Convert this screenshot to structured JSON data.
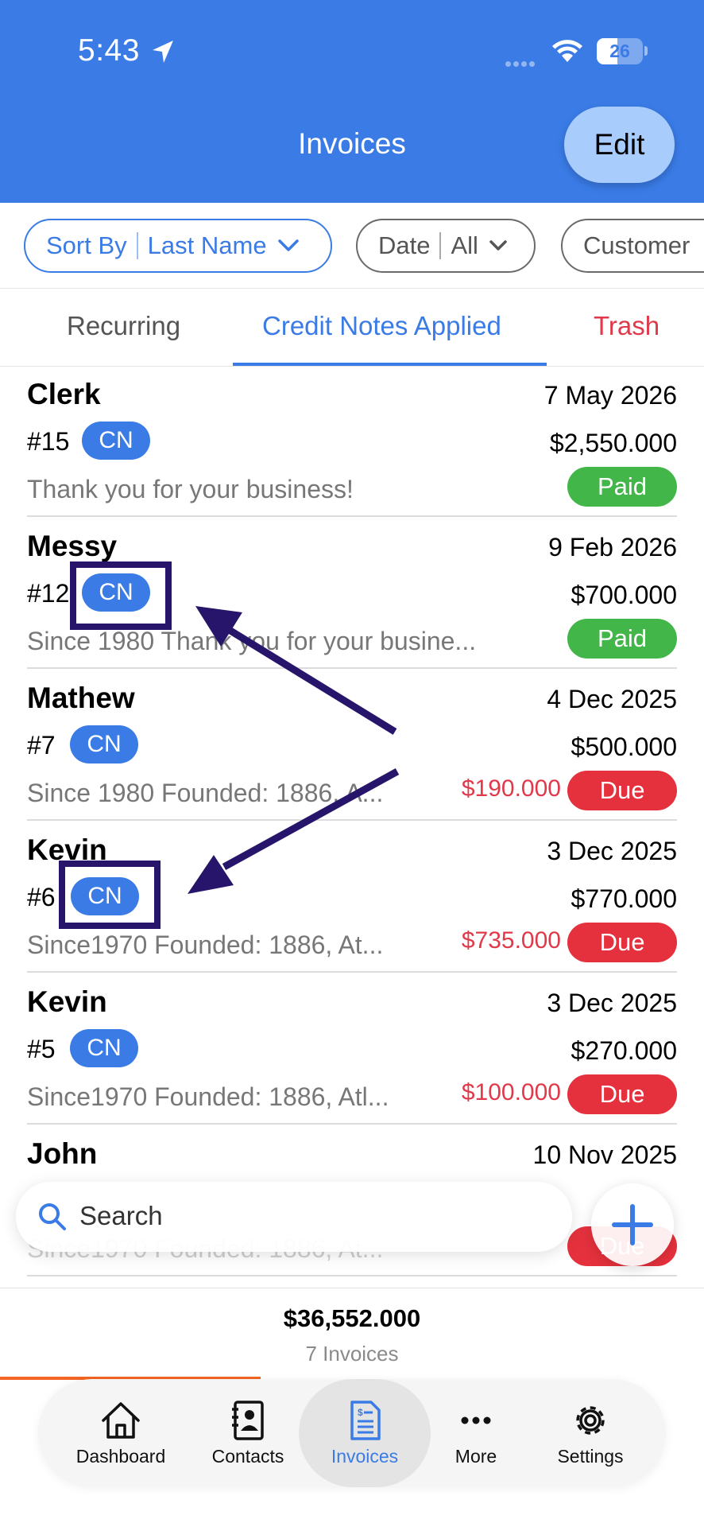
{
  "status_bar": {
    "time": "5:43",
    "battery": "26"
  },
  "header": {
    "title": "Invoices",
    "edit_label": "Edit"
  },
  "filters": [
    {
      "label": "Sort By",
      "value": "Last Name"
    },
    {
      "label": "Date",
      "value": "All"
    },
    {
      "label": "Customer",
      "value": ""
    }
  ],
  "tabs": [
    {
      "label": "Recurring"
    },
    {
      "label": "Credit Notes Applied",
      "active": true
    },
    {
      "label": "Trash"
    }
  ],
  "invoices": [
    {
      "customer": "Clerk",
      "date": "7 May 2026",
      "number": "#15",
      "badge": "CN",
      "amount": "$2,550.000",
      "note": "Thank you for your business!",
      "balance": "",
      "status": "Paid"
    },
    {
      "customer": "Messy",
      "date": "9 Feb 2026",
      "number": "#12",
      "badge": "CN",
      "amount": "$700.000",
      "note": "Since 1980 Thank you for your busine...",
      "balance": "",
      "status": "Paid"
    },
    {
      "customer": "Mathew",
      "date": "4 Dec 2025",
      "number": "#7",
      "badge": "CN",
      "amount": "$500.000",
      "note": "Since 1980 Founded: 1886, A...",
      "balance": "$190.000",
      "status": "Due"
    },
    {
      "customer": "Kevin",
      "date": "3 Dec 2025",
      "number": "#6",
      "badge": "CN",
      "amount": "$770.000",
      "note": "Since1970 Founded: 1886, At...",
      "balance": "$735.000",
      "status": "Due"
    },
    {
      "customer": "Kevin",
      "date": "3 Dec 2025",
      "number": "#5",
      "badge": "CN",
      "amount": "$270.000",
      "note": "Since1970 Founded: 1886, Atl...",
      "balance": "$100.000",
      "status": "Due"
    },
    {
      "customer": "John",
      "date": "10 Nov 2025",
      "number": "",
      "badge": "",
      "amount": "",
      "note": "Since1970 Founded: 1886, At...",
      "balance": "",
      "status": "Due"
    }
  ],
  "search": {
    "placeholder": "Search"
  },
  "totals": {
    "amount": "$36,552.000",
    "count": "7 Invoices"
  },
  "nav": [
    {
      "label": "Dashboard",
      "icon": "house-icon"
    },
    {
      "label": "Contacts",
      "icon": "contacts-book-icon"
    },
    {
      "label": "Invoices",
      "icon": "invoice-document-icon",
      "active": true
    },
    {
      "label": "More",
      "icon": "ellipsis-icon"
    },
    {
      "label": "Settings",
      "icon": "gear-icon"
    }
  ],
  "colors": {
    "header_blue": "#3a7be6",
    "paid_green": "#43b64a",
    "due_red": "#e5313d",
    "balance_red": "#e0394a",
    "annotation_navy": "#26156b",
    "progress_orange": "#f26522"
  }
}
